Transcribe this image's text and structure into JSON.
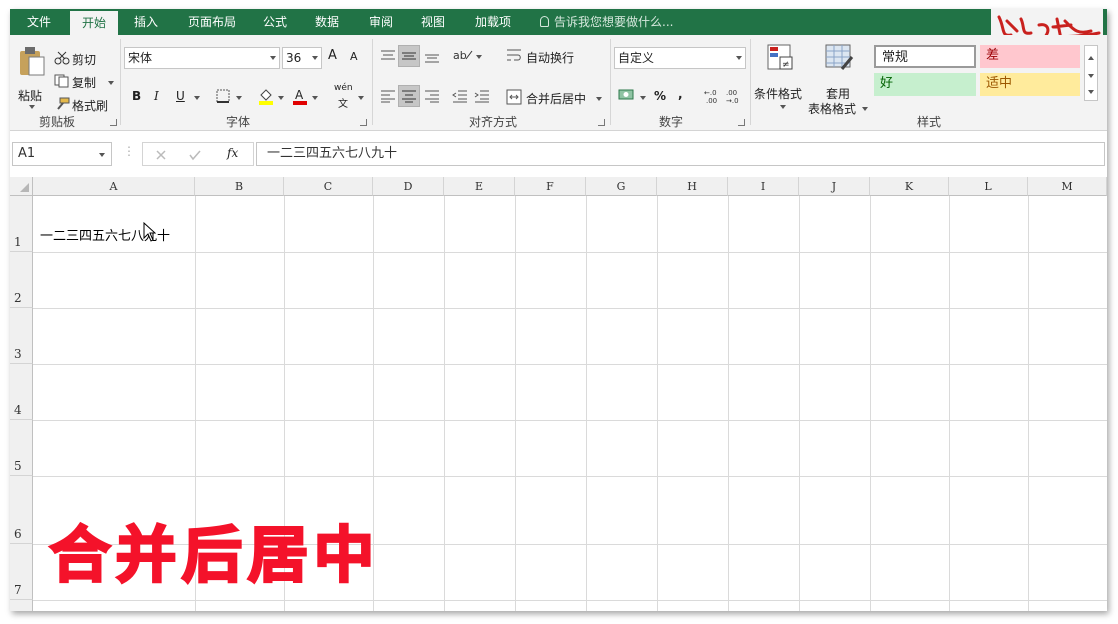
{
  "ribbon_tabs": [
    "文件",
    "开始",
    "插入",
    "页面布局",
    "公式",
    "数据",
    "审阅",
    "视图",
    "加载项"
  ],
  "active_tab": "开始",
  "tell_me": "告诉我您想要做什么...",
  "clipboard": {
    "paste": "粘贴",
    "cut": "剪切",
    "copy": "复制",
    "format_painter": "格式刷",
    "label": "剪贴板"
  },
  "font": {
    "name": "宋体",
    "size": "36",
    "bold": "B",
    "italic": "I",
    "underline": "U",
    "phonetic_top": "wén",
    "phonetic_bottom": "文",
    "grow": "A",
    "shrink": "A",
    "label": "字体"
  },
  "alignment": {
    "wrap": "自动换行",
    "merge": "合并后居中",
    "label": "对齐方式"
  },
  "number": {
    "format": "自定义",
    "percent": "%",
    "comma": ",",
    "inc_decimal": "←.0\n.00",
    "label": "数字"
  },
  "styles": {
    "conditional": "条件格式",
    "table_line1": "套用",
    "table_line2": "表格格式",
    "normal": "常规",
    "bad": "差",
    "good": "好",
    "neutral": "适中",
    "label": "样式"
  },
  "name_box": "A1",
  "fx": "fx",
  "formula_value": "一二三四五六七八九十",
  "columns": [
    "A",
    "B",
    "C",
    "D",
    "E",
    "F",
    "G",
    "H",
    "I",
    "J",
    "K",
    "L",
    "M"
  ],
  "rows": [
    "1",
    "2",
    "3",
    "4",
    "5",
    "6",
    "7"
  ],
  "cell_a1": "一二三四五六七八九十",
  "overlay_caption": "合并后居中",
  "colors": {
    "excel_green": "#217346",
    "bad_fill": "#ffc7ce",
    "bad_text": "#9c0006",
    "good_fill": "#c6efce",
    "good_text": "#006100",
    "neutral_fill": "#ffeb9c",
    "neutral_text": "#9c5700",
    "caption": "#f4122a"
  }
}
